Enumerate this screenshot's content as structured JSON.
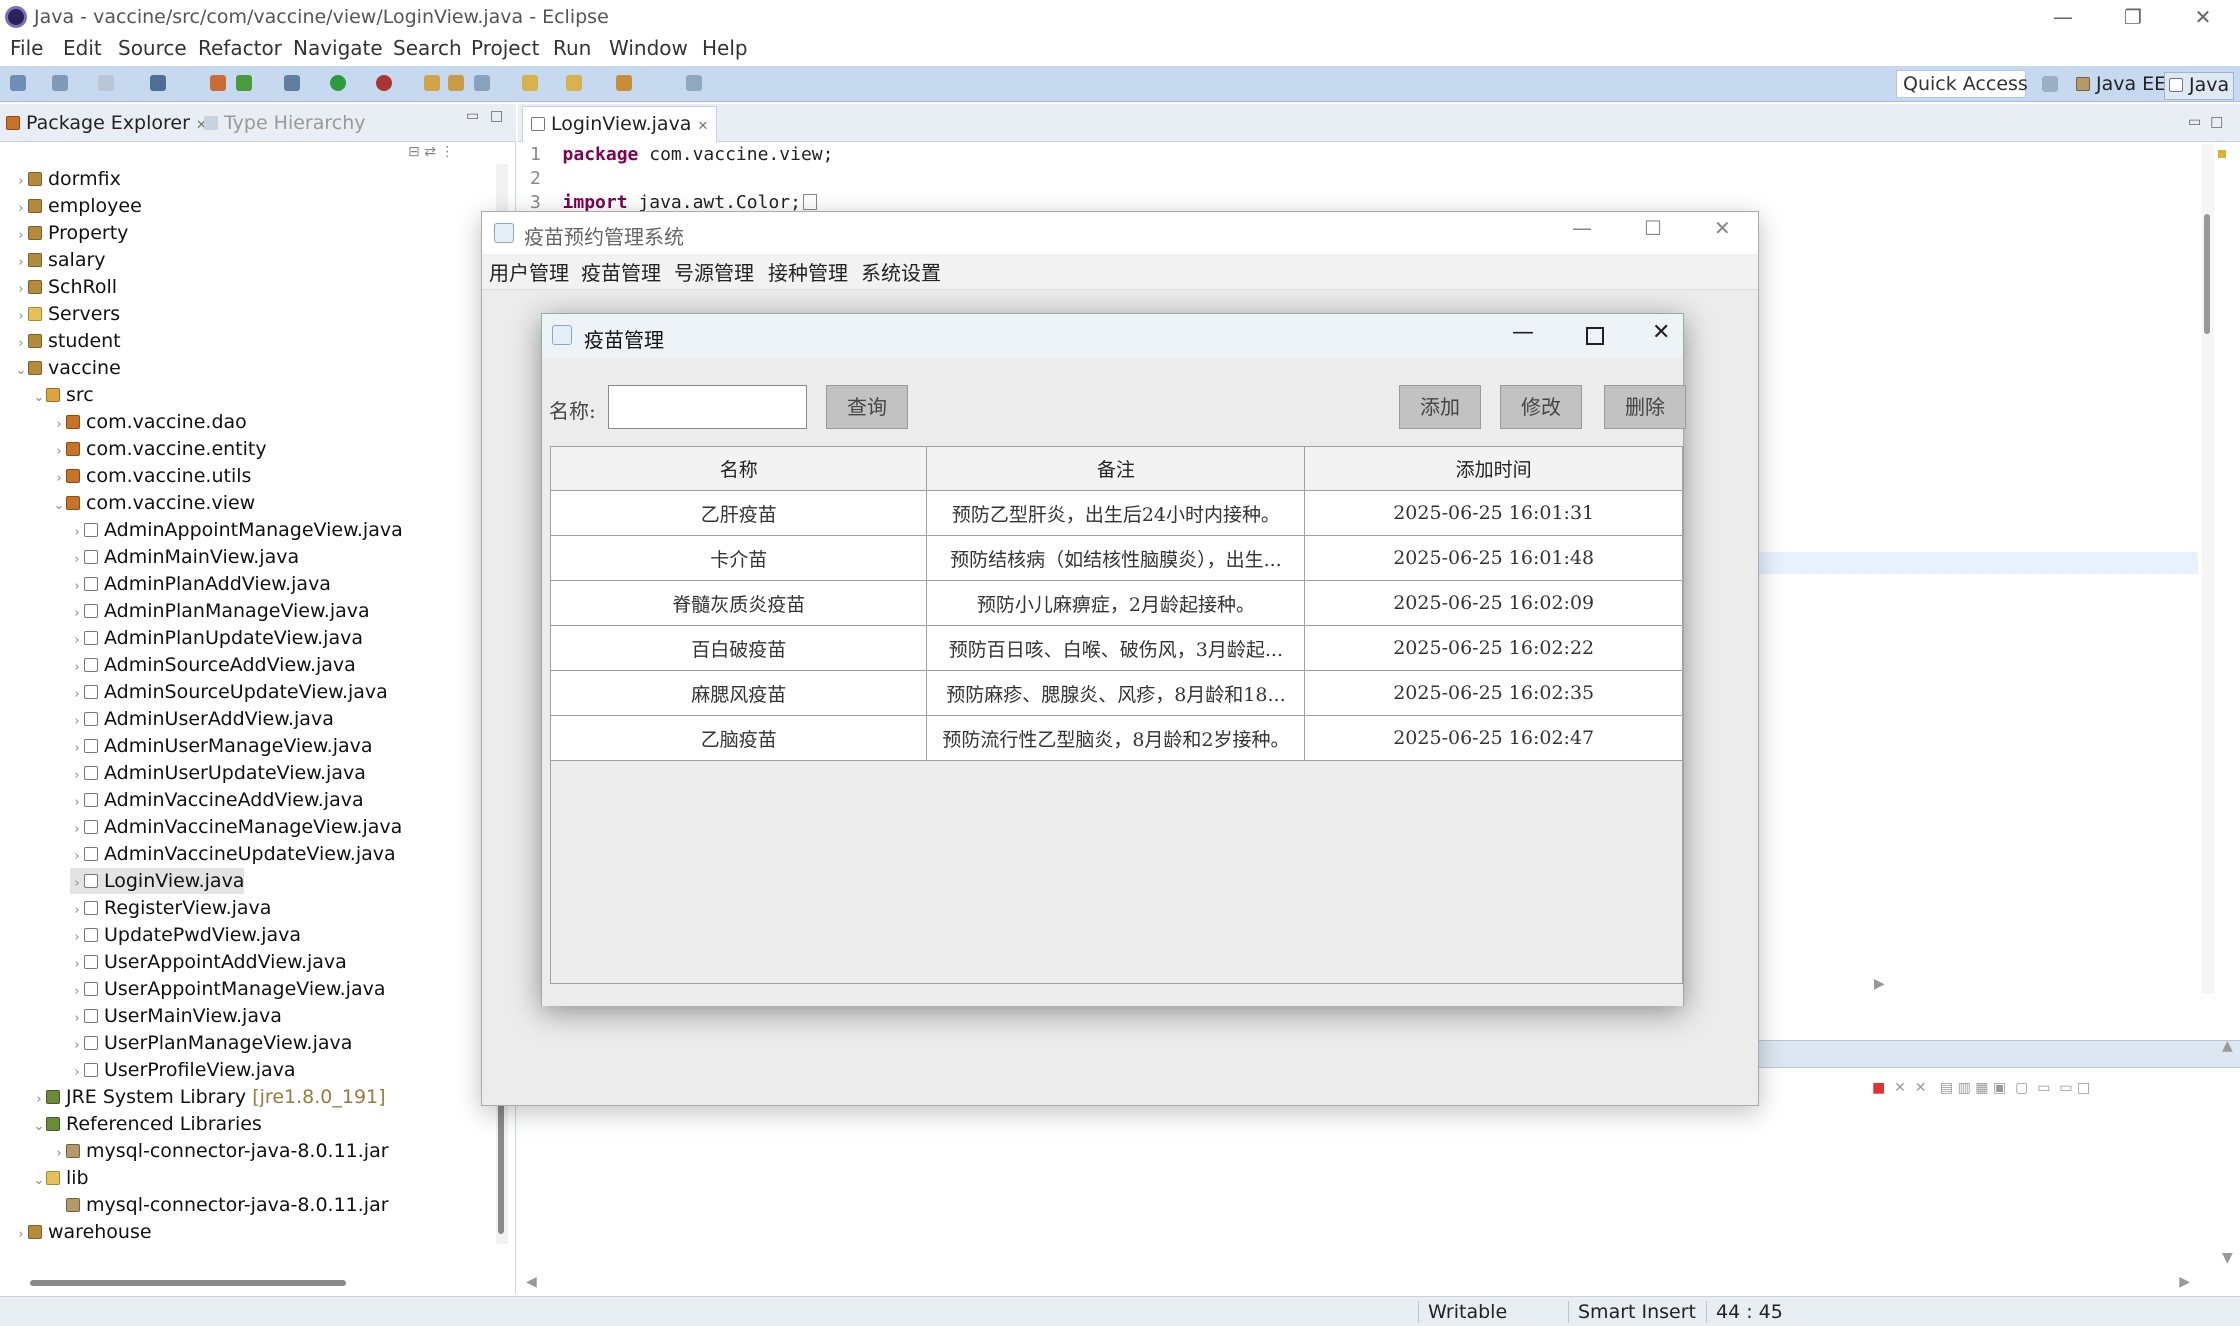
{
  "window": {
    "title": "Java - vaccine/src/com/vaccine/view/LoginView.java - Eclipse"
  },
  "menu": [
    "File",
    "Edit",
    "Source",
    "Refactor",
    "Navigate",
    "Search",
    "Project",
    "Run",
    "Window",
    "Help"
  ],
  "toolbar": {
    "quick_access": "Quick Access",
    "perspectives": [
      "Java EE",
      "Java"
    ]
  },
  "package_explorer": {
    "tabs": [
      "Package Explorer",
      "Type Hierarchy"
    ],
    "items": [
      {
        "label": "dormfix",
        "twisty": "›",
        "icon": "project-icon"
      },
      {
        "label": "employee",
        "twisty": "›",
        "icon": "project-icon"
      },
      {
        "label": "Property",
        "twisty": "›",
        "icon": "project-icon"
      },
      {
        "label": "salary",
        "twisty": "›",
        "icon": "project-icon"
      },
      {
        "label": "SchRoll",
        "twisty": "›",
        "icon": "project-icon"
      },
      {
        "label": "Servers",
        "twisty": "›",
        "icon": "folder-icon"
      },
      {
        "label": "student",
        "twisty": "›",
        "icon": "project-icon"
      },
      {
        "label": "vaccine",
        "twisty": "⌄",
        "icon": "project-icon"
      },
      {
        "label": "src",
        "twisty": "⌄",
        "icon": "source-folder-icon"
      },
      {
        "label": "com.vaccine.dao",
        "twisty": "›",
        "icon": "package-icon"
      },
      {
        "label": "com.vaccine.entity",
        "twisty": "›",
        "icon": "package-icon"
      },
      {
        "label": "com.vaccine.utils",
        "twisty": "›",
        "icon": "package-icon"
      },
      {
        "label": "com.vaccine.view",
        "twisty": "⌄",
        "icon": "package-icon"
      },
      {
        "label": "AdminAppointManageView.java",
        "twisty": "›",
        "icon": "java-file-icon"
      },
      {
        "label": "AdminMainView.java",
        "twisty": "›",
        "icon": "java-file-icon"
      },
      {
        "label": "AdminPlanAddView.java",
        "twisty": "›",
        "icon": "java-file-icon"
      },
      {
        "label": "AdminPlanManageView.java",
        "twisty": "›",
        "icon": "java-file-icon"
      },
      {
        "label": "AdminPlanUpdateView.java",
        "twisty": "›",
        "icon": "java-file-icon"
      },
      {
        "label": "AdminSourceAddView.java",
        "twisty": "›",
        "icon": "java-file-icon"
      },
      {
        "label": "AdminSourceUpdateView.java",
        "twisty": "›",
        "icon": "java-file-icon"
      },
      {
        "label": "AdminUserAddView.java",
        "twisty": "›",
        "icon": "java-file-icon"
      },
      {
        "label": "AdminUserManageView.java",
        "twisty": "›",
        "icon": "java-file-icon"
      },
      {
        "label": "AdminUserUpdateView.java",
        "twisty": "›",
        "icon": "java-file-icon"
      },
      {
        "label": "AdminVaccineAddView.java",
        "twisty": "›",
        "icon": "java-file-icon"
      },
      {
        "label": "AdminVaccineManageView.java",
        "twisty": "›",
        "icon": "java-file-icon"
      },
      {
        "label": "AdminVaccineUpdateView.java",
        "twisty": "›",
        "icon": "java-file-icon"
      },
      {
        "label": "LoginView.java",
        "twisty": "›",
        "icon": "java-file-icon"
      },
      {
        "label": "RegisterView.java",
        "twisty": "›",
        "icon": "java-file-icon"
      },
      {
        "label": "UpdatePwdView.java",
        "twisty": "›",
        "icon": "java-file-icon"
      },
      {
        "label": "UserAppointAddView.java",
        "twisty": "›",
        "icon": "java-file-icon"
      },
      {
        "label": "UserAppointManageView.java",
        "twisty": "›",
        "icon": "java-file-icon"
      },
      {
        "label": "UserMainView.java",
        "twisty": "›",
        "icon": "java-file-icon"
      },
      {
        "label": "UserPlanManageView.java",
        "twisty": "›",
        "icon": "java-file-icon"
      },
      {
        "label": "UserProfileView.java",
        "twisty": "›",
        "icon": "java-file-icon"
      },
      {
        "label": "JRE System Library",
        "suffix": "[jre1.8.0_191]",
        "twisty": "›",
        "icon": "library-icon"
      },
      {
        "label": "Referenced Libraries",
        "twisty": "⌄",
        "icon": "library-icon"
      },
      {
        "label": "mysql-connector-java-8.0.11.jar",
        "twisty": "›",
        "icon": "jar-icon"
      },
      {
        "label": "lib",
        "twisty": "⌄",
        "icon": "folder-icon"
      },
      {
        "label": "mysql-connector-java-8.0.11.jar",
        "twisty": "",
        "icon": "jar-icon"
      },
      {
        "label": "warehouse",
        "twisty": "›",
        "icon": "project-icon"
      }
    ]
  },
  "editor": {
    "tab": "LoginView.java",
    "lines": [
      {
        "num": "1",
        "kw": "package",
        "text": " com.vaccine.view;"
      },
      {
        "num": "2",
        "kw": "",
        "text": ""
      },
      {
        "num": "3",
        "kw": "import",
        "text": " java.awt.Color;"
      }
    ]
  },
  "status": {
    "writable": "Writable",
    "insert": "Smart Insert",
    "position": "44 : 45"
  },
  "main_frame": {
    "title": "疫苗预约管理系统",
    "menu": [
      "用户管理",
      "疫苗管理",
      "号源管理",
      "接种管理",
      "系统设置"
    ]
  },
  "vaccine_dialog": {
    "title": "疫苗管理",
    "name_label": "名称:",
    "search_value": "",
    "buttons": {
      "query": "查询",
      "add": "添加",
      "edit": "修改",
      "delete": "删除"
    },
    "columns": [
      "名称",
      "备注",
      "添加时间"
    ],
    "rows": [
      [
        "乙肝疫苗",
        "预防乙型肝炎，出生后24小时内接种。",
        "2025-06-25 16:01:31"
      ],
      [
        "卡介苗",
        "预防结核病（如结核性脑膜炎），出生...",
        "2025-06-25 16:01:48"
      ],
      [
        "脊髓灰质炎疫苗",
        "预防小儿麻痹症，2月龄起接种。",
        "2025-06-25 16:02:09"
      ],
      [
        "百白破疫苗",
        "预防百日咳、白喉、破伤风，3月龄起...",
        "2025-06-25 16:02:22"
      ],
      [
        "麻腮风疫苗",
        "预防麻疹、腮腺炎、风疹，8月龄和18...",
        "2025-06-25 16:02:35"
      ],
      [
        "乙脑疫苗",
        "预防流行性乙型脑炎，8月龄和2岁接种。",
        "2025-06-25 16:02:47"
      ]
    ]
  }
}
